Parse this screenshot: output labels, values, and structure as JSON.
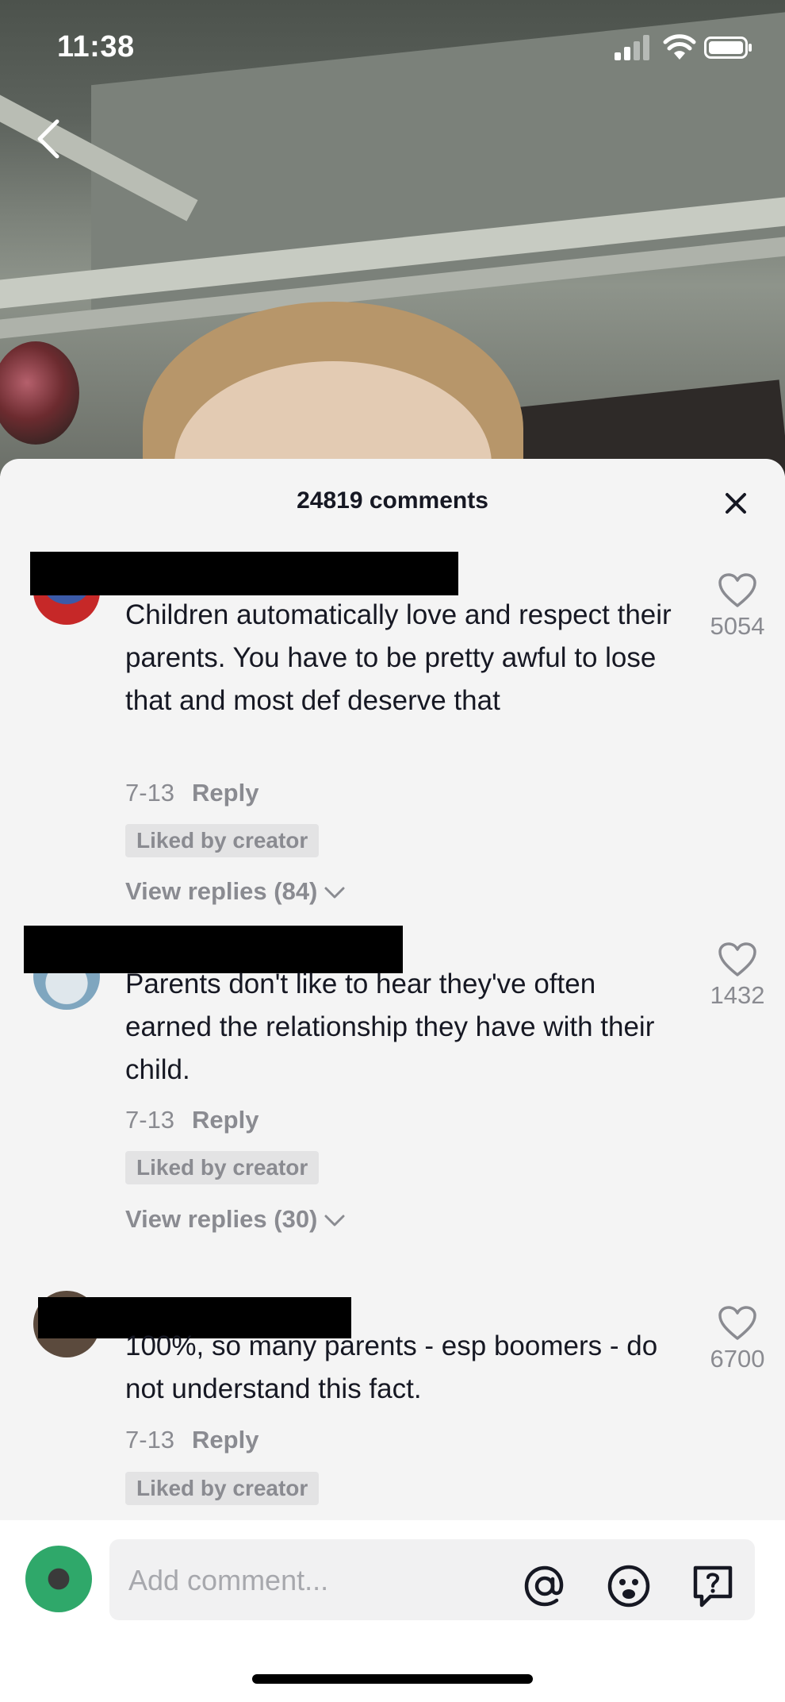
{
  "status_bar": {
    "time": "11:38"
  },
  "sheet": {
    "title": "24819 comments"
  },
  "comments": [
    {
      "text": "Children automatically love and respect their parents. You have to be pretty awful to lose that and most def deserve that",
      "date": "7-13",
      "reply_label": "Reply",
      "liked_by_creator": "Liked by creator",
      "view_replies": "View replies (84)",
      "likes": "5054"
    },
    {
      "text": "Parents don't like to hear they've often earned the relationship they have with their child.",
      "date": "7-13",
      "reply_label": "Reply",
      "liked_by_creator": "Liked by creator",
      "view_replies": "View replies (30)",
      "likes": "1432"
    },
    {
      "text": "100%, so many parents - esp boomers - do not understand this fact.",
      "date": "7-13",
      "reply_label": "Reply",
      "liked_by_creator": "Liked by creator",
      "likes": "6700"
    }
  ],
  "input": {
    "placeholder": "Add comment..."
  },
  "colors": {
    "sheet_bg": "#f4f4f4",
    "text": "#161823",
    "muted": "#8a8b91",
    "redaction": "#000000"
  }
}
